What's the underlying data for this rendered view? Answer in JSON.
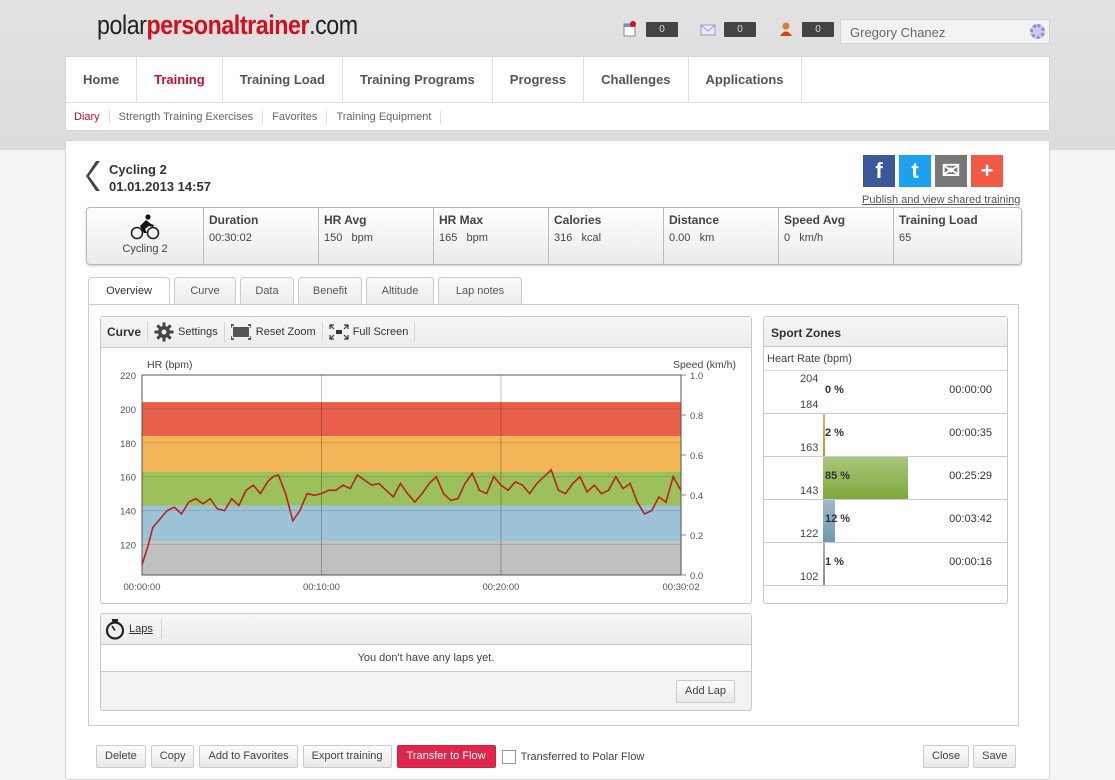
{
  "header": {
    "logo_prefix": "polar",
    "logo_brand": "personaltrainer",
    "logo_suffix": ".com",
    "counters": [
      {
        "icon": "notes-icon",
        "value": "0"
      },
      {
        "icon": "mail-icon",
        "value": "0"
      },
      {
        "icon": "friends-icon",
        "value": "0"
      }
    ],
    "user_name": "Gregory Chanez"
  },
  "nav": {
    "main": [
      "Home",
      "Training",
      "Training Load",
      "Training Programs",
      "Progress",
      "Challenges",
      "Applications"
    ],
    "main_active": "Training",
    "sub": [
      "Diary",
      "Strength Training Exercises",
      "Favorites",
      "Training Equipment"
    ],
    "sub_active": "Diary"
  },
  "training": {
    "name": "Cycling 2",
    "datetime": "01.01.2013 14:57",
    "publish_link": "Publish and view shared training",
    "social": [
      {
        "name": "facebook",
        "glyph": "f",
        "color": "#3b5998"
      },
      {
        "name": "twitter",
        "glyph": "t",
        "color": "#1da1f2"
      },
      {
        "name": "email",
        "glyph": "✉",
        "color": "#777777"
      },
      {
        "name": "more",
        "glyph": "+",
        "color": "#f25a45"
      }
    ]
  },
  "summary": {
    "sport": "Cycling 2",
    "cells": [
      {
        "label": "Duration",
        "value": "00:30:02"
      },
      {
        "label": "HR Avg",
        "value": "150   bpm"
      },
      {
        "label": "HR Max",
        "value": "165   bpm"
      },
      {
        "label": "Calories",
        "value": "316   kcal"
      },
      {
        "label": "Distance",
        "value": "0.00   km"
      },
      {
        "label": "Speed Avg",
        "value": "0   km/h"
      },
      {
        "label": "Training Load",
        "value": "65"
      }
    ]
  },
  "tabs": [
    "Overview",
    "Curve",
    "Data",
    "Benefit",
    "Altitude",
    "Lap notes"
  ],
  "tabs_active": "Overview",
  "curve_toolbar": {
    "title": "Curve",
    "settings": "Settings",
    "reset_zoom": "Reset Zoom",
    "full_screen": "Full Screen"
  },
  "chart_data": {
    "type": "line",
    "title": "",
    "ylabel": "HR (bpm)",
    "y2label": "Speed (km/h)",
    "ylim": [
      102,
      220
    ],
    "y2lim": [
      0.0,
      1.0
    ],
    "yticks": [
      120,
      140,
      160,
      180,
      200,
      220
    ],
    "y2ticks": [
      "0.0",
      "0.2",
      "0.4",
      "0.6",
      "0.8",
      "1.0"
    ],
    "xticks": [
      "00:00:00",
      "00:10:00",
      "00:20:00",
      "00:30:02"
    ],
    "xlim_seconds": [
      0,
      1802
    ],
    "zones": [
      {
        "from": 102,
        "to": 122,
        "color": "#c0c0c0"
      },
      {
        "from": 122,
        "to": 143,
        "color": "#9dc3d6"
      },
      {
        "from": 143,
        "to": 163,
        "color": "#9cc15a"
      },
      {
        "from": 163,
        "to": 184,
        "color": "#f3b556"
      },
      {
        "from": 184,
        "to": 204,
        "color": "#e8604c"
      }
    ],
    "series": [
      {
        "name": "HR",
        "color": "#b3261e",
        "x_minutes": [
          0,
          0.3,
          0.6,
          1,
          1.4,
          1.8,
          2.2,
          2.6,
          3,
          3.4,
          3.8,
          4.2,
          4.6,
          5,
          5.4,
          5.8,
          6.2,
          6.6,
          7,
          7.3,
          7.6,
          8,
          8.4,
          8.8,
          9.2,
          9.6,
          10,
          10.4,
          10.8,
          11.2,
          11.6,
          12,
          12.4,
          12.8,
          13.2,
          13.6,
          14,
          14.4,
          14.8,
          15.2,
          15.6,
          16,
          16.4,
          16.8,
          17.2,
          17.6,
          18,
          18.4,
          18.8,
          19.2,
          19.6,
          20,
          20.4,
          20.8,
          21.2,
          21.6,
          22,
          22.4,
          22.8,
          23.2,
          23.6,
          24,
          24.4,
          24.8,
          25.2,
          25.6,
          26,
          26.4,
          26.8,
          27.2,
          27.6,
          28,
          28.4,
          28.8,
          29.2,
          29.6,
          30.03
        ],
        "values": [
          108,
          118,
          130,
          135,
          140,
          142,
          138,
          145,
          147,
          144,
          147,
          141,
          140,
          147,
          143,
          152,
          155,
          150,
          157,
          160,
          161,
          150,
          134,
          140,
          150,
          149,
          150,
          152,
          152,
          155,
          153,
          161,
          158,
          155,
          156,
          152,
          148,
          156,
          150,
          145,
          150,
          156,
          160,
          150,
          146,
          147,
          156,
          162,
          152,
          150,
          160,
          155,
          152,
          157,
          155,
          150,
          156,
          160,
          164,
          152,
          150,
          156,
          160,
          151,
          155,
          150,
          152,
          160,
          153,
          156,
          145,
          138,
          140,
          148,
          145,
          160,
          152
        ]
      }
    ]
  },
  "sport_zones": {
    "title": "Sport Zones",
    "subtitle": "Heart Rate (bpm)",
    "rows": [
      {
        "hi": "204",
        "lo": "184",
        "percent": 0,
        "pct_label": "0 %",
        "time": "00:00:00",
        "color": "#e8604c"
      },
      {
        "hi": "",
        "lo": "163",
        "percent": 2,
        "pct_label": "2 %",
        "time": "00:00:35",
        "color": "#d98a2a"
      },
      {
        "hi": "",
        "lo": "143",
        "percent": 85,
        "pct_label": "85 %",
        "time": "00:25:29",
        "color": "#7fa83a"
      },
      {
        "hi": "",
        "lo": "122",
        "percent": 12,
        "pct_label": "12 %",
        "time": "00:03:42",
        "color": "#6f98b0"
      },
      {
        "hi": "",
        "lo": "102",
        "percent": 1,
        "pct_label": "1 %",
        "time": "00:00:16",
        "color": "#888888"
      }
    ]
  },
  "laps": {
    "title": "Laps",
    "empty_message": "You don't have any laps yet.",
    "add_button": "Add Lap"
  },
  "footer": {
    "delete": "Delete",
    "copy": "Copy",
    "add_favorites": "Add to Favorites",
    "export": "Export training",
    "transfer": "Transfer to Flow",
    "transferred_label": "Transferred to Polar Flow",
    "transferred_checked": false,
    "close": "Close",
    "save": "Save"
  }
}
